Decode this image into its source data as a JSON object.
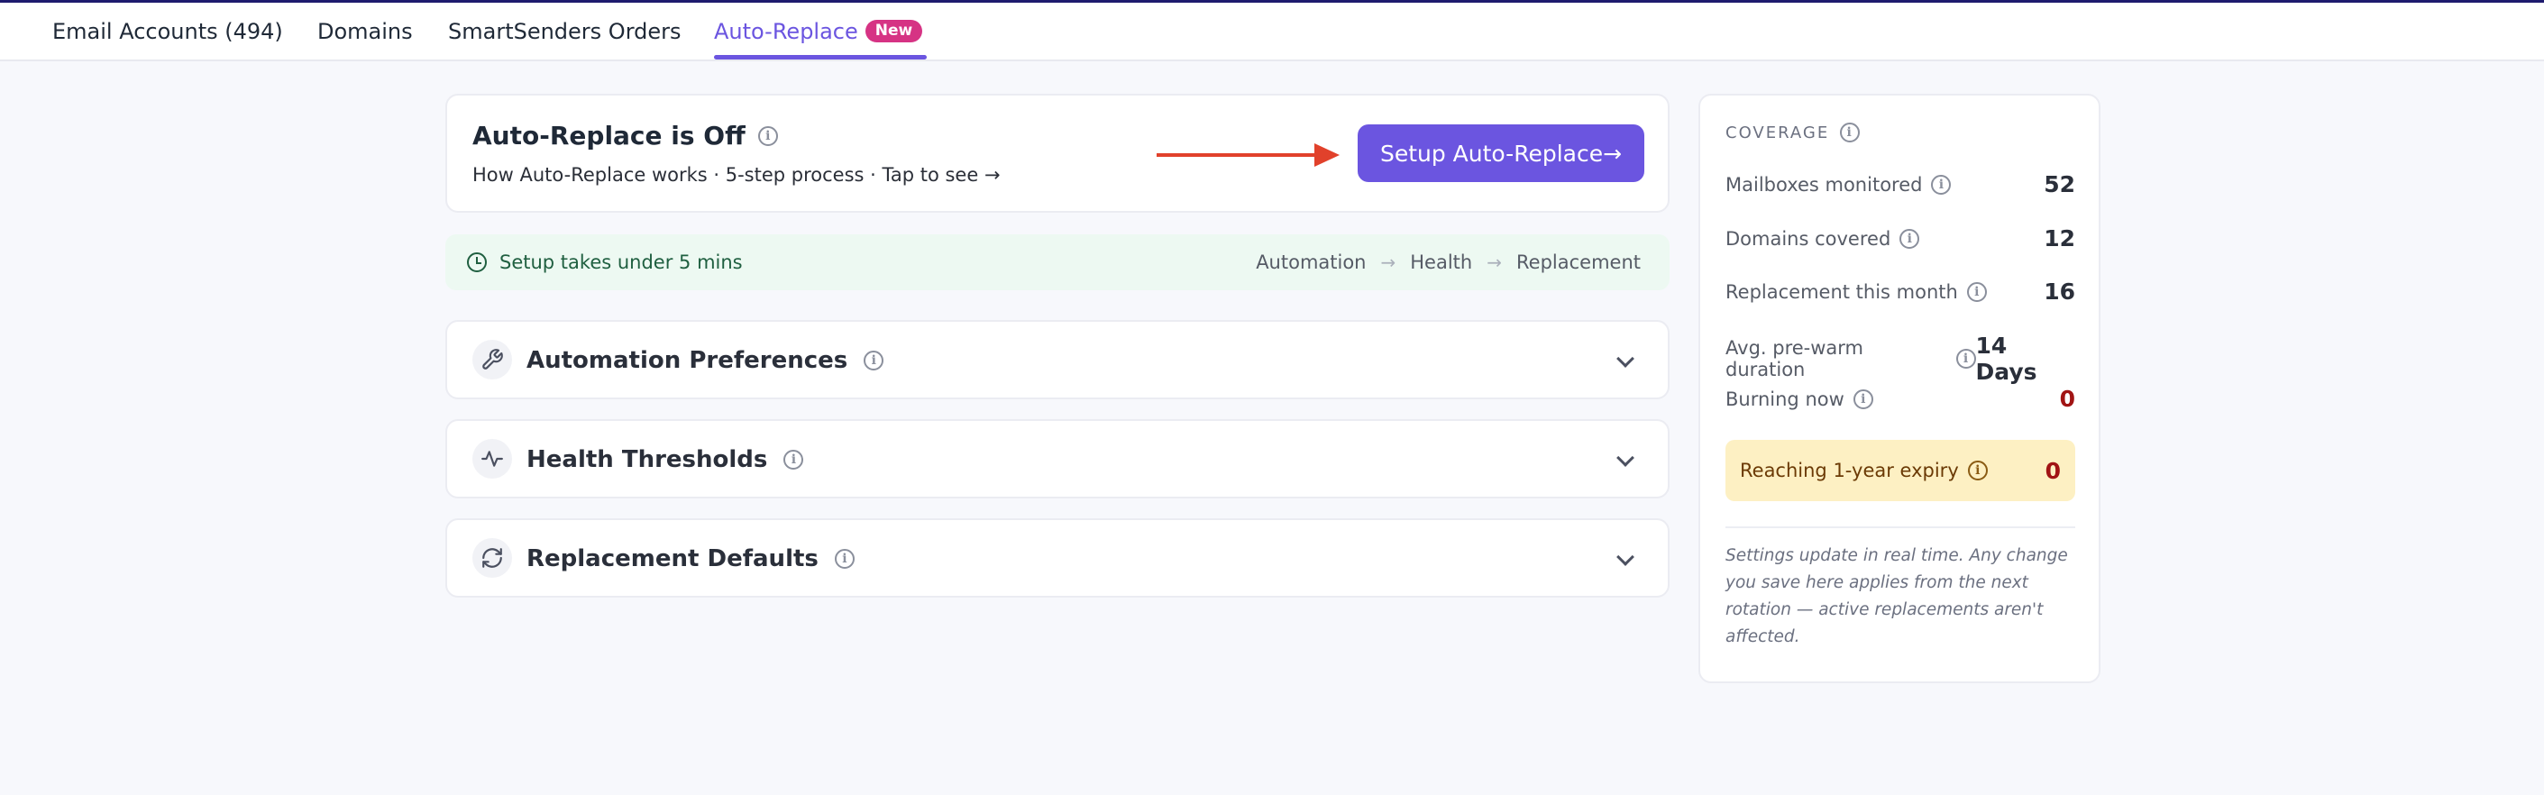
{
  "tabs": [
    {
      "label": "Email Accounts (494)",
      "active": false
    },
    {
      "label": "Domains",
      "active": false
    },
    {
      "label": "SmartSenders Orders",
      "active": false
    },
    {
      "label": "Auto-Replace",
      "active": true,
      "badge": "New"
    }
  ],
  "hero": {
    "title": "Auto-Replace is Off",
    "subtitle": "How Auto-Replace works · 5-step process · Tap to see →",
    "button_label": "Setup Auto-Replace→"
  },
  "notice": {
    "text": "Setup takes under 5 mins",
    "steps": [
      "Automation",
      "Health",
      "Replacement"
    ]
  },
  "sections": [
    {
      "title": "Automation Preferences",
      "icon": "wrench-icon"
    },
    {
      "title": "Health Thresholds",
      "icon": "pulse-icon"
    },
    {
      "title": "Replacement Defaults",
      "icon": "refresh-icon"
    }
  ],
  "coverage": {
    "title": "COVERAGE",
    "stats": [
      {
        "label": "Mailboxes monitored",
        "value": "52"
      },
      {
        "label": "Domains covered",
        "value": "12"
      },
      {
        "label": "Replacement this month",
        "value": "16"
      },
      {
        "label": "Avg. pre-warm duration",
        "value": "14 Days"
      },
      {
        "label": "Burning now",
        "value": "0"
      }
    ],
    "expiry": {
      "label": "Reaching 1-year expiry",
      "value": "0"
    },
    "note": "Settings update in real time. Any change you save here applies from the next rotation — active replacements aren't affected."
  },
  "colors": {
    "accent": "#6b55e0",
    "badge": "#d63384",
    "arrow": "#e1412b",
    "notice_bg": "#edf9f2",
    "expiry_bg": "#fdf0c3",
    "danger_value": "#a11414"
  }
}
